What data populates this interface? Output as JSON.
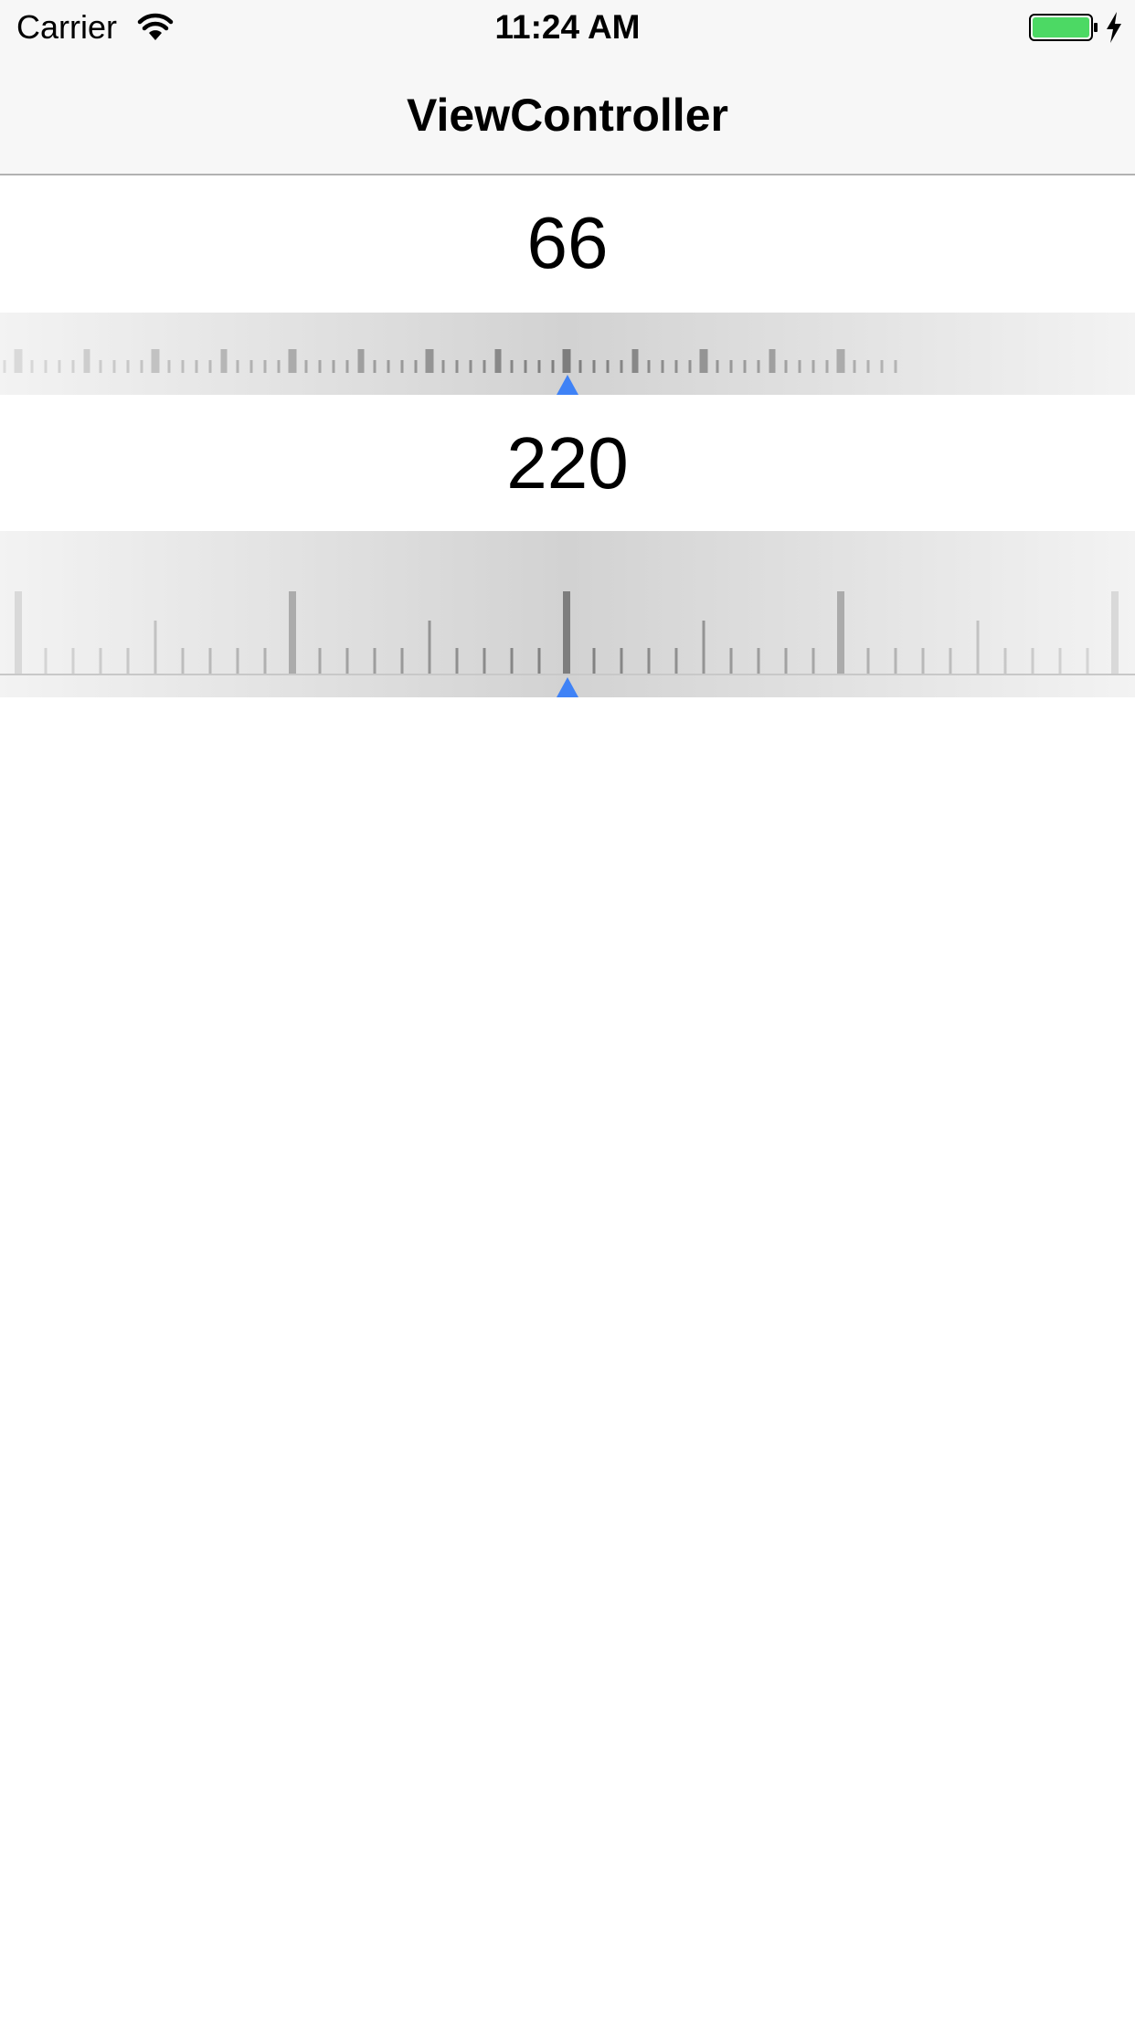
{
  "status_bar": {
    "carrier": "Carrier",
    "time": "11:24 AM",
    "icons": [
      "wifi-icon",
      "battery-icon",
      "charging-icon"
    ],
    "battery_color": "#4cd964"
  },
  "nav_bar": {
    "title": "ViewController"
  },
  "rulers": [
    {
      "value": "66",
      "pointer_color": "#3f82f6"
    },
    {
      "value": "220",
      "pointer_color": "#3f82f6"
    }
  ]
}
